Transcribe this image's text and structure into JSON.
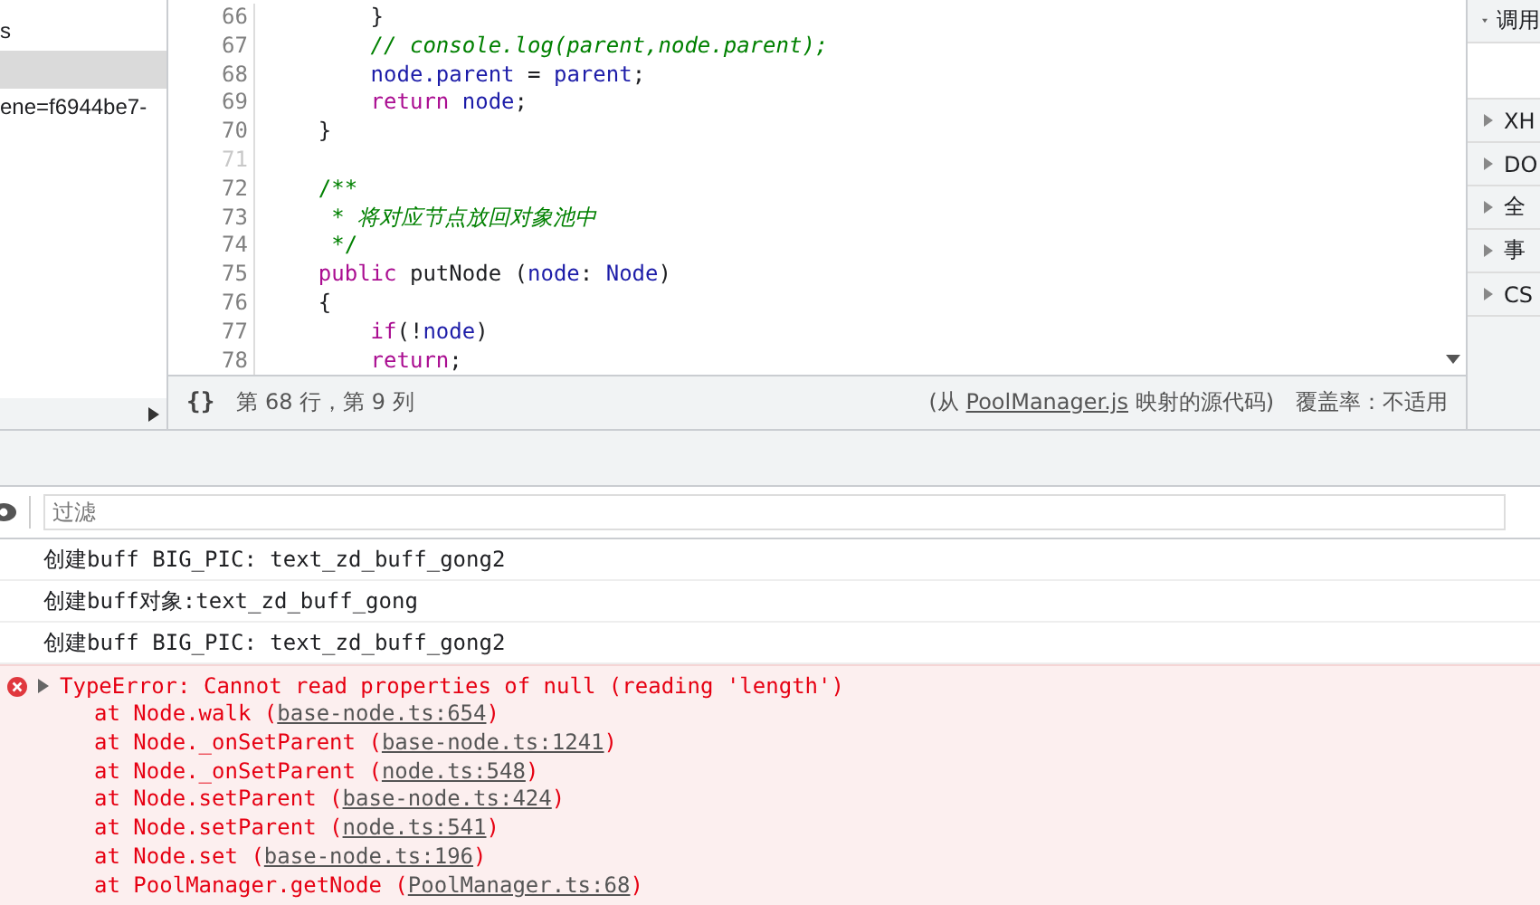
{
  "sidebar": {
    "items": [
      {
        "label": "s",
        "selected": false
      },
      {
        "selected": true
      },
      {
        "label": "ene=f6944be7-",
        "selected": false
      }
    ]
  },
  "editor": {
    "lines": [
      {
        "number": "66",
        "tokens": [
          {
            "kind": "plain",
            "text": "        }"
          }
        ]
      },
      {
        "number": "67",
        "tokens": [
          {
            "kind": "comment",
            "text": "        // console.log(parent,node.parent);"
          }
        ]
      },
      {
        "number": "68",
        "tokens": [
          {
            "kind": "var",
            "text": "        node.parent"
          },
          {
            "kind": "plain",
            "text": " = "
          },
          {
            "kind": "var",
            "text": "parent"
          },
          {
            "kind": "plain",
            "text": ";"
          }
        ]
      },
      {
        "number": "69",
        "tokens": [
          {
            "kind": "keyword",
            "text": "        return"
          },
          {
            "kind": "var",
            "text": " node"
          },
          {
            "kind": "plain",
            "text": ";"
          }
        ]
      },
      {
        "number": "70",
        "tokens": [
          {
            "kind": "plain",
            "text": "    }"
          }
        ]
      },
      {
        "number": "71"
      },
      {
        "number": "72",
        "tokens": [
          {
            "kind": "doc",
            "text": "    /**"
          }
        ]
      },
      {
        "number": "73",
        "tokens": [
          {
            "kind": "comment",
            "text": "     * 将对应节点放回对象池中"
          }
        ]
      },
      {
        "number": "74",
        "tokens": [
          {
            "kind": "doc",
            "text": "     */"
          }
        ]
      },
      {
        "number": "75",
        "tokens": [
          {
            "kind": "keyword",
            "text": "    public"
          },
          {
            "kind": "plain",
            "text": " putNode ("
          },
          {
            "kind": "var",
            "text": "node"
          },
          {
            "kind": "plain",
            "text": ": "
          },
          {
            "kind": "type",
            "text": "Node"
          },
          {
            "kind": "plain",
            "text": ")"
          }
        ]
      },
      {
        "number": "76",
        "tokens": [
          {
            "kind": "plain",
            "text": "    {"
          }
        ]
      },
      {
        "number": "77",
        "tokens": [
          {
            "kind": "keyword",
            "text": "        if"
          },
          {
            "kind": "plain",
            "text": "(!"
          },
          {
            "kind": "var",
            "text": "node"
          },
          {
            "kind": "plain",
            "text": ")"
          }
        ]
      },
      {
        "number": "78",
        "tokens": [
          {
            "kind": "keyword",
            "text": "        return"
          },
          {
            "kind": "plain",
            "text": ";"
          }
        ]
      }
    ]
  },
  "status_bar": {
    "format_button": "{}",
    "position": "第 68 行，第 9 列",
    "source_prefix": "(从 ",
    "source_link": "PoolManager.js",
    "source_suffix": " 映射的源代码)",
    "coverage": "覆盖率：不适用"
  },
  "right_panel": {
    "sections": [
      {
        "label": "调用",
        "expanded": true
      },
      {
        "label": "XH",
        "expanded": false
      },
      {
        "label": "DO",
        "expanded": false
      },
      {
        "label": "全",
        "expanded": false
      },
      {
        "label": "事",
        "expanded": false
      },
      {
        "label": "CS",
        "expanded": false
      }
    ]
  },
  "console": {
    "filter": {
      "placeholder": "过滤"
    },
    "messages": [
      {
        "kind": "log",
        "text": "创建buff BIG_PIC: text_zd_buff_gong2"
      },
      {
        "kind": "log",
        "text": "创建buff对象:text_zd_buff_gong"
      },
      {
        "kind": "log",
        "text": "创建buff BIG_PIC: text_zd_buff_gong2"
      },
      {
        "kind": "error",
        "expanded": false,
        "text": "TypeError: Cannot read properties of null (reading 'length')",
        "stack": [
          {
            "prefix": "at Node.walk (",
            "link": "base-node.ts:654",
            "suffix": ")"
          },
          {
            "prefix": "at Node._onSetParent (",
            "link": "base-node.ts:1241",
            "suffix": ")"
          },
          {
            "prefix": "at Node._onSetParent (",
            "link": "node.ts:548",
            "suffix": ")"
          },
          {
            "prefix": "at Node.setParent (",
            "link": "base-node.ts:424",
            "suffix": ")"
          },
          {
            "prefix": "at Node.setParent (",
            "link": "node.ts:541",
            "suffix": ")"
          },
          {
            "prefix": "at Node.set (",
            "link": "base-node.ts:196",
            "suffix": ")"
          },
          {
            "prefix": "at PoolManager.getNode (",
            "link": "PoolManager.ts:68",
            "suffix": ")"
          }
        ]
      }
    ]
  }
}
